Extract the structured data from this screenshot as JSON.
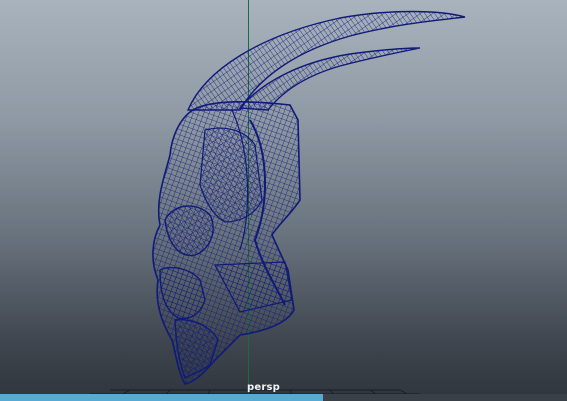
{
  "viewport": {
    "camera_name": "persp",
    "progress_fraction": 0.57,
    "colors": {
      "wireframe": "#101a7a",
      "axis": "#1f6a3a",
      "progress": "#5aa8d4"
    }
  }
}
